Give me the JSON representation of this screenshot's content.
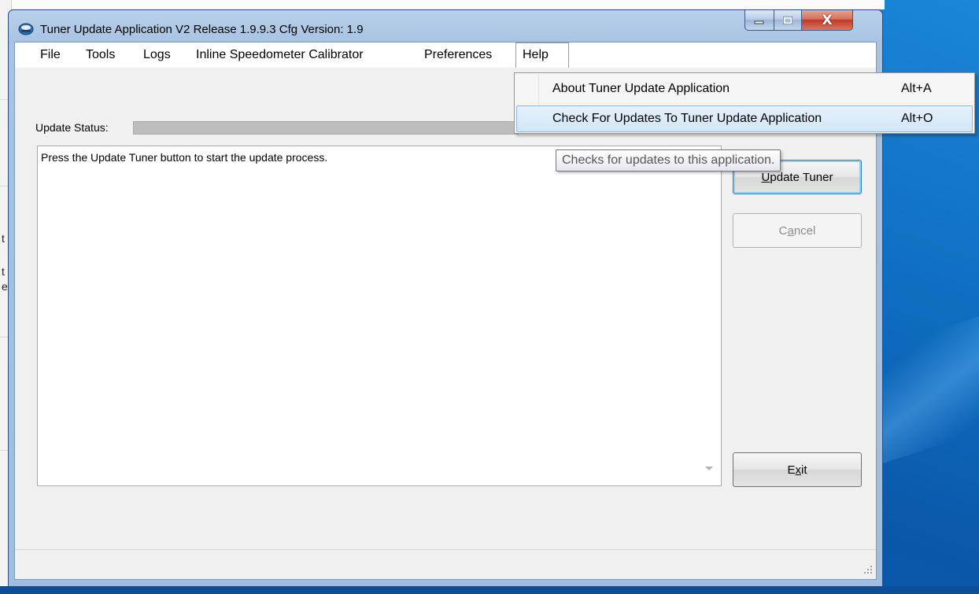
{
  "window": {
    "title": "Tuner Update Application V2 Release 1.9.9.3  Cfg Version: 1.9",
    "close_glyph": "X"
  },
  "menubar": {
    "items": [
      {
        "label": "File"
      },
      {
        "label": "Tools"
      },
      {
        "label": "Logs"
      },
      {
        "label": "Inline Speedometer Calibrator"
      },
      {
        "label": "Preferences"
      },
      {
        "label": "Help"
      }
    ]
  },
  "help_menu": {
    "items": [
      {
        "label": "About Tuner Update Application",
        "shortcut": "Alt+A"
      },
      {
        "label": "Check For Updates To Tuner Update Application",
        "shortcut": "Alt+O"
      }
    ]
  },
  "tooltip": {
    "text": "Checks for updates to this application."
  },
  "status": {
    "label": "Update Status:"
  },
  "log": {
    "text": "Press the Update Tuner button to start the update process."
  },
  "buttons": {
    "update_prefix": "",
    "update_underlined": "U",
    "update_rest": "pdate Tuner",
    "cancel_prefix": "C",
    "cancel_underlined": "a",
    "cancel_rest": "ncel",
    "exit_prefix": "E",
    "exit_underlined": "x",
    "exit_rest": "it"
  },
  "background_window": {
    "chars": [
      "t",
      "t",
      "e"
    ]
  },
  "colors": {
    "desktop": "#0f6cc0",
    "menu_hover": "#d1e6f8",
    "close_button": "#c0392b"
  }
}
